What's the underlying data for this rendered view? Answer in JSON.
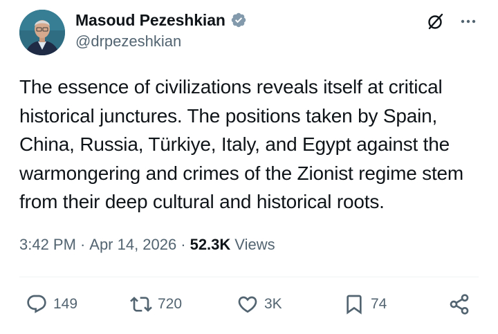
{
  "author": {
    "display_name": "Masoud Pezeshkian",
    "handle": "@drpezeshkian",
    "verified": true
  },
  "tweet": {
    "text": "The essence of civilizations reveals itself at critical historical junctures. The positions taken by Spain, China, Russia, Türkiye, Italy, and Egypt against the warmongering and crimes of the Zionist regime stem from their deep cultural and historical roots."
  },
  "meta": {
    "time": "3:42 PM",
    "separator": "·",
    "date": "Apr 14, 2026",
    "views_count": "52.3K",
    "views_label": "Views"
  },
  "actions": {
    "replies": "149",
    "reposts": "720",
    "likes": "3K",
    "bookmarks": "74"
  },
  "icons": {
    "verified": "verified-badge-icon",
    "grok": "grok-icon",
    "more": "more-options-icon",
    "reply": "reply-icon",
    "repost": "repost-icon",
    "like": "heart-icon",
    "bookmark": "bookmark-icon",
    "share": "share-icon"
  },
  "colors": {
    "text": "#0f1419",
    "secondary": "#536471",
    "divider": "#eff3f4",
    "verified_badge": "#829aab"
  }
}
